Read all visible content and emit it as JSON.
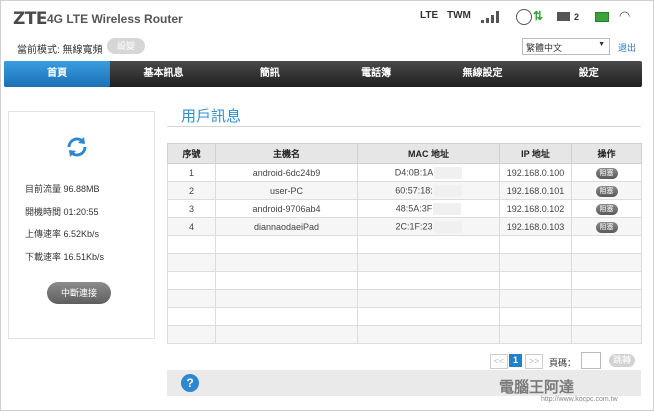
{
  "header": {
    "logo": "ZTE",
    "product": "4G LTE Wireless Router",
    "network_type": "LTE",
    "carrier": "TWM",
    "sms_count": "2",
    "icons": [
      "signal-icon",
      "globe-icon",
      "data-arrows-icon",
      "mail-icon",
      "battery-icon",
      "wifi-icon"
    ]
  },
  "subbar": {
    "mode_label": "當前模式: 無線寬頻",
    "change_button": "設變",
    "language": "繁體中文",
    "logout": "退出"
  },
  "nav": {
    "tabs": [
      "首頁",
      "基本訊息",
      "簡訊",
      "電話簿",
      "無線設定",
      "設定"
    ],
    "active": "首頁"
  },
  "status_panel": {
    "traffic": "目前流量 96.88MB",
    "uptime": "開機時間 01:20:55",
    "upload": "上傳速率 6.52Kb/s",
    "download": "下載速率 16.51Kb/s",
    "disconnect_button": "中斷連接"
  },
  "users": {
    "title": "用戶訊息",
    "columns": [
      "序號",
      "主機名",
      "MAC 地址",
      "IP 地址",
      "操作"
    ],
    "rows": [
      {
        "no": "1",
        "host": "android-6dc24b9",
        "mac": "D4:0B:1A",
        "ip": "192.168.0.100",
        "action": "阻塞"
      },
      {
        "no": "2",
        "host": "user-PC",
        "mac": "60:57:18:",
        "ip": "192.168.0.101",
        "action": "阻塞"
      },
      {
        "no": "3",
        "host": "android-9706ab4",
        "mac": "48:5A:3F",
        "ip": "192.168.0.102",
        "action": "阻塞"
      },
      {
        "no": "4",
        "host": "diannaodaeiPad",
        "mac": "2C:1F:23",
        "ip": "192.168.0.103",
        "action": "阻塞"
      }
    ]
  },
  "pagination": {
    "prev": "<<",
    "current": "1",
    "next": ">>",
    "page_label": "頁碼：",
    "go_button": "跳轉"
  },
  "footer": {
    "help": "?",
    "watermark": "電腦王阿達",
    "watermark_url": "http://www.kocpc.com.tw"
  }
}
